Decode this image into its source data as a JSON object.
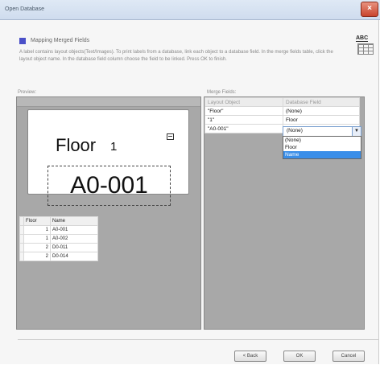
{
  "window": {
    "title": "Open Database",
    "close_label": "×"
  },
  "header": {
    "title": "Mapping Merged Fields",
    "description": "A label contains layout objects(Text/Images). To print labels from a database, link each object to a database field. In the merge fields table, click the layout object name. In the database field column choose the field to be linked. Press OK to finish."
  },
  "preview": {
    "label": "Preview:",
    "floor_word": "Floor",
    "floor_number": "1",
    "code": "A0-001"
  },
  "data_table": {
    "headers": [
      "Floor",
      "Name"
    ],
    "rows": [
      {
        "floor": "1",
        "name": "A0-001"
      },
      {
        "floor": "1",
        "name": "A0-002"
      },
      {
        "floor": "2",
        "name": "D0-011"
      },
      {
        "floor": "2",
        "name": "D0-014"
      }
    ]
  },
  "merge_fields": {
    "label": "Merge Fields:",
    "headers": [
      "Layout Object",
      "Database Field"
    ],
    "rows": [
      {
        "object": "\"Floor\"",
        "field": "(None)"
      },
      {
        "object": "\"1\"",
        "field": "Floor"
      },
      {
        "object": "\"A0-001\"",
        "field": "(None)"
      }
    ],
    "dropdown": {
      "selected": "(None)",
      "options": [
        "(None)",
        "Floor",
        "Name"
      ],
      "highlighted": "Name",
      "highlight_color": "#3a8ee8"
    }
  },
  "buttons": {
    "back": "< Back",
    "ok": "OK",
    "cancel": "Cancel"
  }
}
